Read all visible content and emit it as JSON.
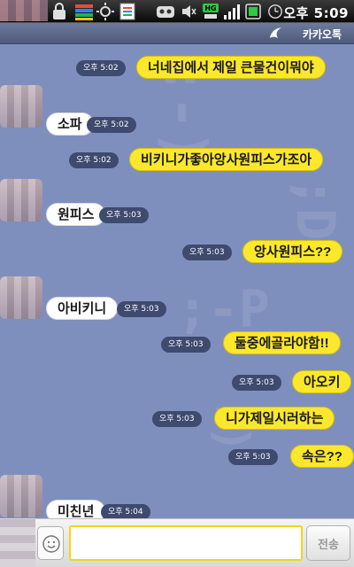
{
  "status_bar": {
    "time": "오후 5:09",
    "icons": [
      "lock-icon",
      "books-icon",
      "sun-icon",
      "sheet-icon",
      "game-icon",
      "mute-icon",
      "hg-network-icon",
      "signal-icon",
      "battery-card-icon",
      "battery-icon",
      "clock-icon"
    ],
    "network_label": "HG"
  },
  "header": {
    "brand": "카카오톡"
  },
  "messages": [
    {
      "side": "sent",
      "text": "너네집에서 제일 큰물건이뭐야",
      "time": "오후 5:02"
    },
    {
      "side": "recv",
      "text": "소파",
      "time": "오후 5:02"
    },
    {
      "side": "sent",
      "text": "비키니가좋아앙사원피스가조아",
      "time": "오후 5:02"
    },
    {
      "side": "recv",
      "text": "원피스",
      "time": "오후 5:03"
    },
    {
      "side": "sent",
      "text": "앙사원피스??",
      "time": "오후 5:03"
    },
    {
      "side": "recv",
      "text": "아비키니",
      "time": "오후 5:03"
    },
    {
      "side": "sent",
      "text": "둘중에골라야함!!",
      "time": "오후 5:03"
    },
    {
      "side": "sent",
      "text": "아오키",
      "time": "오후 5:03"
    },
    {
      "side": "sent",
      "text": "니가제일시러하는",
      "time": "오후 5:03"
    },
    {
      "side": "sent",
      "text": "속은??",
      "time": "오후 5:03"
    },
    {
      "side": "recv",
      "text": "미친년",
      "time": "오후 5:04"
    }
  ],
  "input_bar": {
    "placeholder": "",
    "value": "",
    "send_label": "전송"
  },
  "colors": {
    "chat_bg": "#7f8fbd",
    "sent_bubble": "#fbe82c",
    "recv_bubble": "#ffffff",
    "time_pill": "#3e4a6e",
    "input_border": "#f3d51d"
  }
}
